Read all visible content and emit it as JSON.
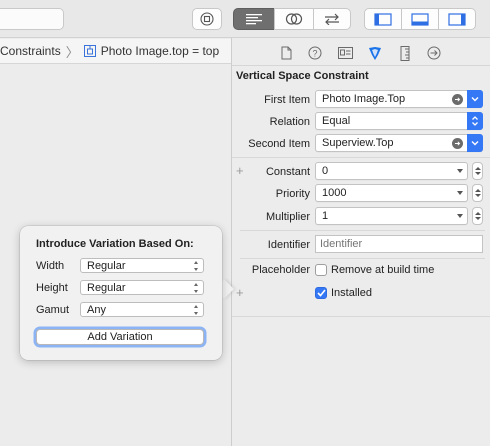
{
  "jumpbar": {
    "item1": "Constraints",
    "item2": "Photo Image.top = top"
  },
  "inspector": {
    "section_title": "Vertical Space Constraint",
    "first_item_label": "First Item",
    "first_item_value": "Photo Image.Top",
    "relation_label": "Relation",
    "relation_value": "Equal",
    "second_item_label": "Second Item",
    "second_item_value": "Superview.Top",
    "constant_label": "Constant",
    "constant_value": "0",
    "priority_label": "Priority",
    "priority_value": "1000",
    "multiplier_label": "Multiplier",
    "multiplier_value": "1",
    "identifier_label": "Identifier",
    "identifier_placeholder": "Identifier",
    "placeholder_label": "Placeholder",
    "remove_at_build_label": "Remove at build time",
    "installed_label": "Installed",
    "installed_checked": true,
    "remove_checked": false
  },
  "popover": {
    "title": "Introduce Variation Based On:",
    "width_label": "Width",
    "width_value": "Regular",
    "height_label": "Height",
    "height_value": "Regular",
    "gamut_label": "Gamut",
    "gamut_value": "Any",
    "add_button": "Add Variation"
  },
  "icons": {
    "toolbar": [
      "stop-icon",
      "editor-standard-icon",
      "assistant-icon",
      "version-icon",
      "navigator-toggle-icon",
      "debug-toggle-icon",
      "inspector-toggle-icon"
    ],
    "inspector_tabs": [
      "file-icon",
      "help-icon",
      "identity-icon",
      "attributes-icon",
      "size-icon",
      "connections-icon"
    ]
  },
  "colors": {
    "accent": "#3478f6",
    "selected_tab": "#1a73e8"
  }
}
